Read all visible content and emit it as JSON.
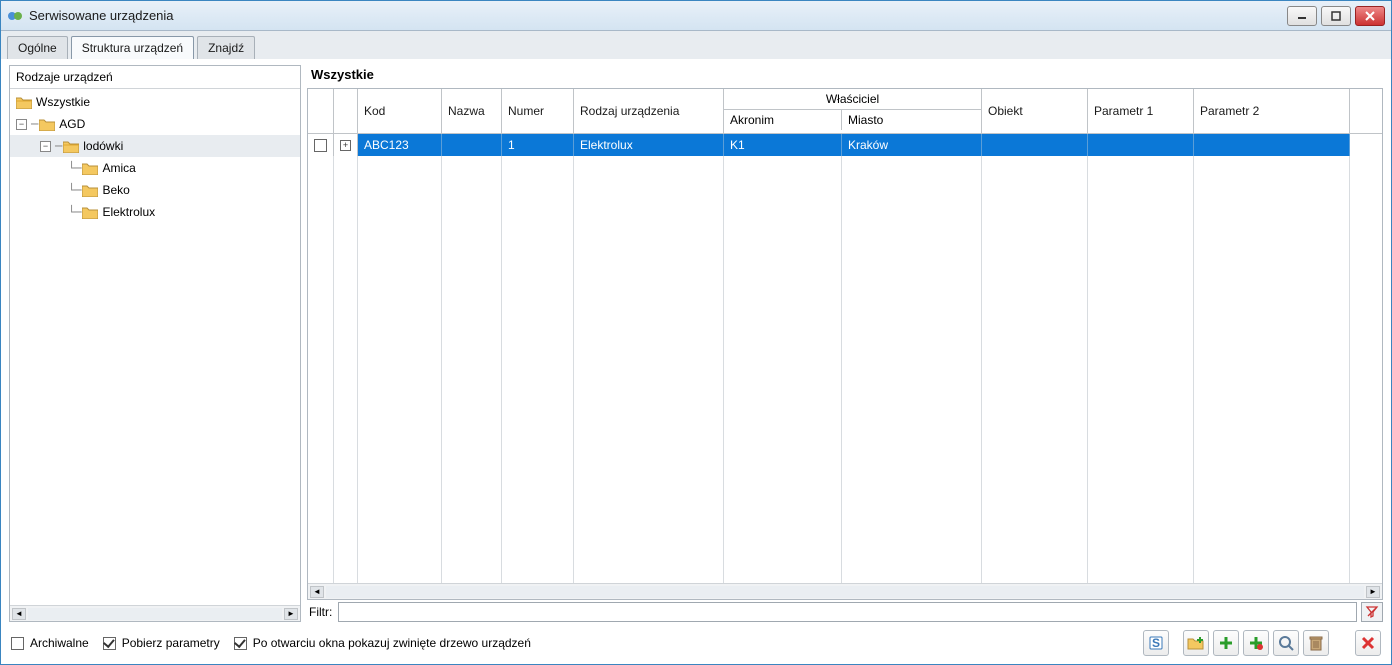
{
  "window": {
    "title": "Serwisowane urządzenia"
  },
  "tabs": [
    {
      "label": "Ogólne",
      "active": false
    },
    {
      "label": "Struktura urządzeń",
      "active": true
    },
    {
      "label": "Znajdź",
      "active": false
    }
  ],
  "tree": {
    "header": "Rodzaje urządzeń",
    "nodes": [
      {
        "label": "Wszystkie",
        "indent": 0,
        "toggle": null,
        "open": true
      },
      {
        "label": "AGD",
        "indent": 1,
        "toggle": "-",
        "open": false
      },
      {
        "label": "lodówki",
        "indent": 2,
        "toggle": "-",
        "open": true,
        "selected": true
      },
      {
        "label": "Amica",
        "indent": 3,
        "toggle": null
      },
      {
        "label": "Beko",
        "indent": 3,
        "toggle": null
      },
      {
        "label": "Elektrolux",
        "indent": 3,
        "toggle": null
      }
    ]
  },
  "grid": {
    "heading": "Wszystkie",
    "columns": {
      "kod": "Kod",
      "nazwa": "Nazwa",
      "numer": "Numer",
      "rodzaj": "Rodzaj urządzenia",
      "wlasciciel": "Właściciel",
      "akronim": "Akronim",
      "miasto": "Miasto",
      "obiekt": "Obiekt",
      "par1": "Parametr 1",
      "par2": "Parametr 2"
    },
    "rows": [
      {
        "kod": "ABC123",
        "nazwa": "",
        "numer": "1",
        "rodzaj": "Elektrolux",
        "akronim": "K1",
        "miasto": "Kraków",
        "obiekt": "",
        "par1": "",
        "par2": "",
        "selected": true
      }
    ]
  },
  "filter": {
    "label": "Filtr:",
    "value": ""
  },
  "bottom": {
    "archive": "Archiwalne",
    "fetch_params": "Pobierz parametry",
    "collapsed_tree": "Po otwarciu okna pokazuj zwinięte drzewo urządzeń"
  }
}
